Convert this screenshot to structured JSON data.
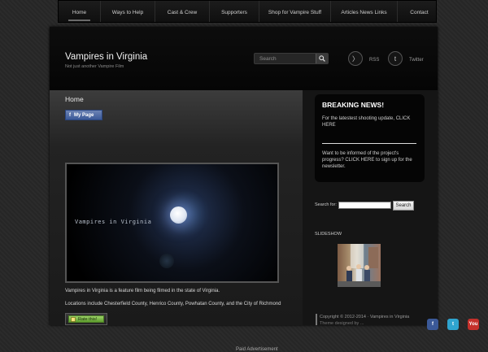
{
  "nav": {
    "items": [
      {
        "label": "Home"
      },
      {
        "label": "Ways to Help"
      },
      {
        "label": "Cast & Crew"
      },
      {
        "label": "Supporters"
      },
      {
        "label": "Shop for Vampire Stuff"
      },
      {
        "label": "Articles News Links"
      },
      {
        "label": "Contact"
      }
    ]
  },
  "header": {
    "site_title": "Vampires in Virginia",
    "tagline": "Not just another Vampire Film",
    "search_placeholder": "Search",
    "rss_label": "RSS",
    "twitter_label": "Twitter",
    "rss_glyph": "〉",
    "twitter_glyph": "t"
  },
  "main": {
    "page_title": "Home",
    "mypage_label": "My Page",
    "mypage_glyph": "f",
    "video_title": "Vampires in Virginia",
    "paragraph1": "Vampires in Virginia is a feature film being filmed in the state of Virginia.",
    "paragraph2": "Locations include Chesterfield County, Henrico County, Powhatan County, and the City of Richmond",
    "rate_label": "Rate this!",
    "paid_ad": "Paid Advertisement"
  },
  "sidebar": {
    "breaking_title": "BREAKING NEWS!",
    "breaking_text1": "For the latestest shooting update, CLICK HERE",
    "breaking_text2": "Want to be informed of the project's progress? CLICK HERE to sign up for the newsletter.",
    "search_label": "Search for:",
    "search_button": "Search",
    "slideshow_label": "SLIDESHOW",
    "copyright": "Copyright © 2012-2014 · Vampires in Virginia",
    "theme_credit": "Theme designed by ..."
  },
  "social_bottom": [
    {
      "glyph": "f",
      "color": "#3b5998"
    },
    {
      "glyph": "t",
      "color": "#2fa4cf"
    },
    {
      "glyph": "You",
      "color": "#c4302b"
    }
  ],
  "icons": [
    "search-icon",
    "rss-icon",
    "twitter-icon",
    "facebook-icon",
    "rate-icon"
  ]
}
